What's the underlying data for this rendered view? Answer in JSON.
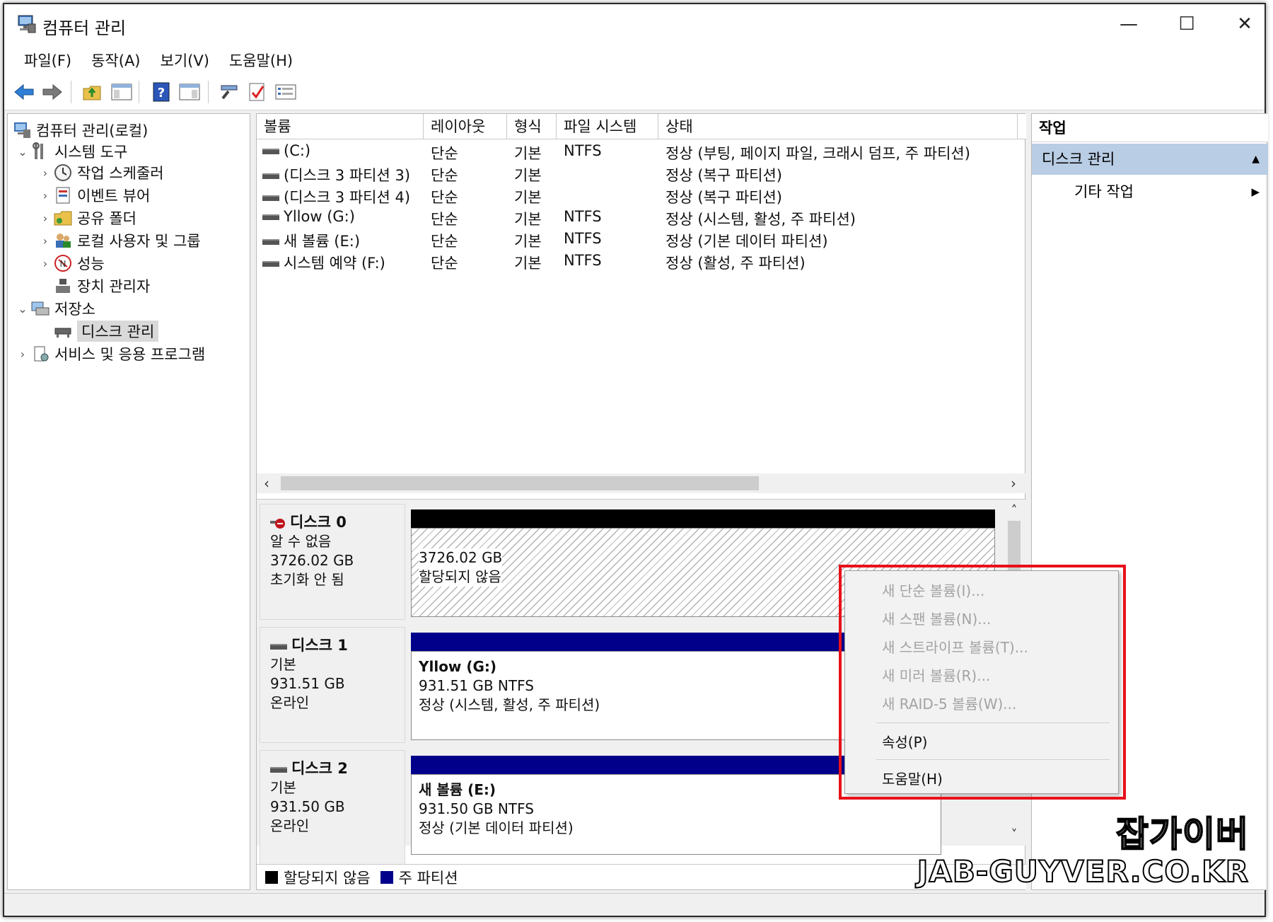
{
  "window": {
    "title": "컴퓨터 관리",
    "minimize_glyph": "—",
    "maximize_glyph": "☐",
    "close_glyph": "✕"
  },
  "menu": [
    "파일(F)",
    "동작(A)",
    "보기(V)",
    "도움말(H)"
  ],
  "tree": {
    "root": "컴퓨터 관리(로컬)",
    "items": [
      {
        "label": "시스템 도구",
        "arrow": "⌄",
        "level": 1,
        "icon": "tools-icon"
      },
      {
        "label": "작업 스케줄러",
        "arrow": "›",
        "level": 2,
        "icon": "clock-icon"
      },
      {
        "label": "이벤트 뷰어",
        "arrow": "›",
        "level": 2,
        "icon": "event-viewer-icon"
      },
      {
        "label": "공유 폴더",
        "arrow": "›",
        "level": 2,
        "icon": "shared-folder-icon"
      },
      {
        "label": "로컬 사용자 및 그룹",
        "arrow": "›",
        "level": 2,
        "icon": "users-icon"
      },
      {
        "label": "성능",
        "arrow": "›",
        "level": 2,
        "icon": "performance-icon"
      },
      {
        "label": "장치 관리자",
        "arrow": "",
        "level": 2,
        "icon": "device-manager-icon"
      },
      {
        "label": "저장소",
        "arrow": "⌄",
        "level": 1,
        "icon": "storage-icon"
      },
      {
        "label": "디스크 관리",
        "arrow": "",
        "level": 2,
        "icon": "disk-management-icon",
        "selected": true
      },
      {
        "label": "서비스 및 응용 프로그램",
        "arrow": "›",
        "level": 1,
        "icon": "services-icon"
      }
    ]
  },
  "volumes": {
    "columns": [
      "볼륨",
      "레이아웃",
      "형식",
      "파일 시스템",
      "상태"
    ],
    "rows": [
      [
        "(C:)",
        "단순",
        "기본",
        "NTFS",
        "정상 (부팅, 페이지 파일, 크래시 덤프, 주 파티션)"
      ],
      [
        "(디스크 3 파티션 3)",
        "단순",
        "기본",
        "",
        "정상 (복구 파티션)"
      ],
      [
        "(디스크 3 파티션 4)",
        "단순",
        "기본",
        "",
        "정상 (복구 파티션)"
      ],
      [
        "Yllow (G:)",
        "단순",
        "기본",
        "NTFS",
        "정상 (시스템, 활성, 주 파티션)"
      ],
      [
        "새 볼륨 (E:)",
        "단순",
        "기본",
        "NTFS",
        "정상 (기본 데이터 파티션)"
      ],
      [
        "시스템 예약 (F:)",
        "단순",
        "기본",
        "NTFS",
        "정상 (활성, 주 파티션)"
      ]
    ]
  },
  "disks": [
    {
      "name": "디스크 0",
      "type": "알 수 없음",
      "size": "3726.02 GB",
      "status": "초기화 안 됨",
      "bar_color": "#000000",
      "partition": {
        "name": "",
        "size": "3726.02 GB",
        "status": "할당되지 않음",
        "hatched": true
      }
    },
    {
      "name": "디스크 1",
      "type": "기본",
      "size": "931.51 GB",
      "status": "온라인",
      "bar_color": "#00008b",
      "partition": {
        "name": "Yllow  (G:)",
        "size": "931.51 GB NTFS",
        "status": "정상 (시스템, 활성, 주 파티션)",
        "hatched": false
      }
    },
    {
      "name": "디스크 2",
      "type": "기본",
      "size": "931.50 GB",
      "status": "온라인",
      "bar_color": "#00008b",
      "partition": {
        "name": "새 볼륨  (E:)",
        "size": "931.50 GB NTFS",
        "status": "정상 (기본 데이터 파티션)",
        "hatched": false
      }
    }
  ],
  "legend": [
    {
      "label": "할당되지 않음",
      "color": "#000000"
    },
    {
      "label": "주 파티션",
      "color": "#00008b"
    }
  ],
  "actions": {
    "header": "작업",
    "section": "디스크 관리",
    "item": "기타 작업"
  },
  "context_menu": {
    "items": [
      {
        "label": "새 단순 볼륨(I)...",
        "enabled": false
      },
      {
        "label": "새 스팬 볼륨(N)...",
        "enabled": false
      },
      {
        "label": "새 스트라이프 볼륨(T)...",
        "enabled": false
      },
      {
        "label": "새 미러 볼륨(R)...",
        "enabled": false
      },
      {
        "label": "새 RAID-5 볼륨(W)...",
        "enabled": false
      },
      {
        "label": "속성(P)",
        "enabled": true
      },
      {
        "label": "도움말(H)",
        "enabled": true
      }
    ],
    "highlight_color": "#e8101a"
  },
  "watermark": {
    "korean": "잡가이버",
    "english": "JAB-GUYVER.CO.KR"
  }
}
